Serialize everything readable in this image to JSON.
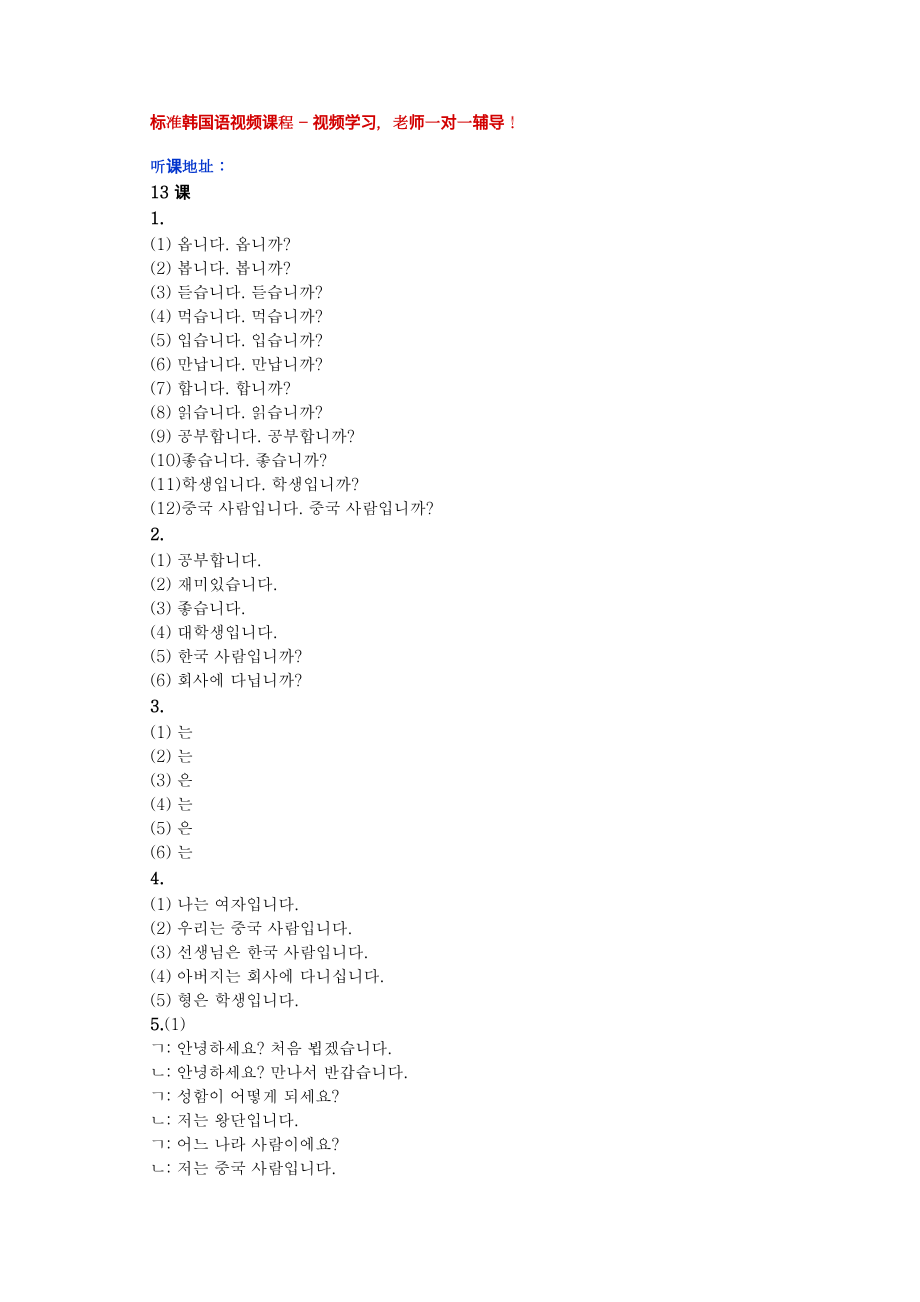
{
  "header": {
    "title_red": "标准韩国语视频课程 – 视频学习，老师一对一辅导！",
    "link_label": "听课地址：",
    "lesson": "13 课"
  },
  "sections": [
    {
      "num": "1.",
      "items": [
        "(1)  옵니다.  옵니까?",
        "(2)  봅니다.  봅니까?",
        "(3)  듣습니다.  듣습니까?",
        "(4)  먹습니다.  먹습니까?",
        "(5)  입습니다.  입습니까?",
        "(6)  만납니다.  만납니까?",
        "(7)  합니다.  합니까?",
        "(8)  읽습니다.  읽습니까?",
        "(9)  공부합니다.  공부합니까?",
        "(10)좋습니다.  좋습니까?",
        "(11)학생입니다.  학생입니까?",
        "(12)중국  사람입니다.  중국  사람입니까?"
      ]
    },
    {
      "num": "2.",
      "items": [
        "(1)  공부합니다.",
        "(2)  재미있습니다.",
        "(3)  좋습니다.",
        "(4)  대학생입니다.",
        "(5)  한국  사람입니까?",
        "(6)  회사에  다닙니까?"
      ]
    },
    {
      "num": "3.",
      "items": [
        "(1)  는",
        "(2)  는",
        "(3)  은",
        "(4)  는",
        "(5)  은",
        "(6)  는"
      ]
    },
    {
      "num": "4.",
      "items": [
        "(1)  나는  여자입니다.",
        "(2)  우리는  중국  사람입니다.",
        "(3)  선생님은  한국  사람입니다.",
        "(4)  아버지는  회사에  다니십니다.",
        "(5)  형은  학생입니다."
      ]
    },
    {
      "num": "5.",
      "inline_first": "(1)",
      "items": [
        "ㄱ:  안녕하세요?  처음  뵙겠습니다.",
        "ㄴ:  안녕하세요?  만나서  반갑습니다.",
        "ㄱ:  성함이  어떻게  되세요?",
        "ㄴ:  저는  왕단입니다.",
        "ㄱ:  어느  나라  사람이에요?",
        "ㄴ:  저는  중국  사람입니다."
      ]
    }
  ]
}
